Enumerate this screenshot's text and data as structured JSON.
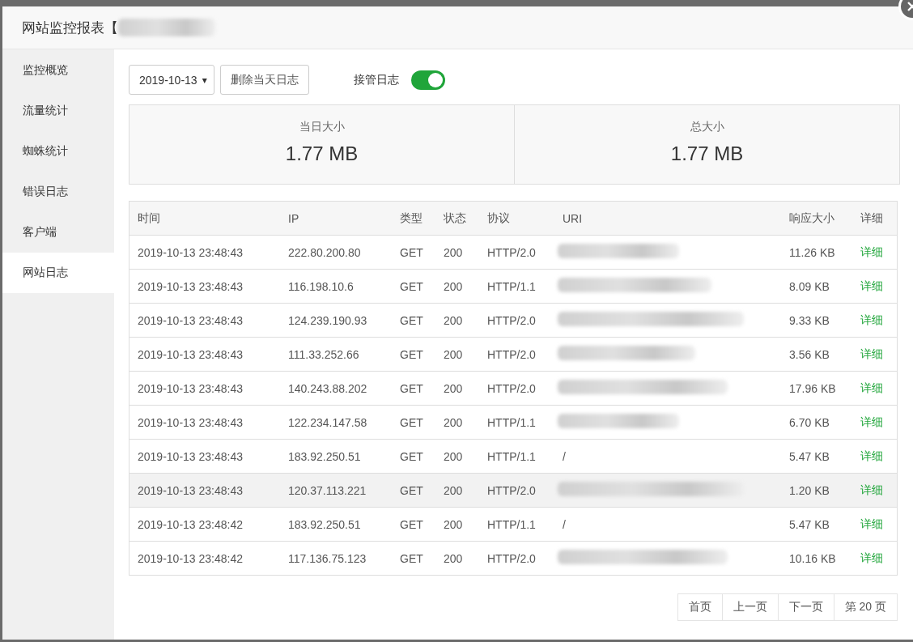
{
  "dialog": {
    "title": "网站监控报表【",
    "title_redacted": true
  },
  "sidebar": {
    "items": [
      {
        "label": "监控概览",
        "selected": false
      },
      {
        "label": "流量统计",
        "selected": false
      },
      {
        "label": "蜘蛛统计",
        "selected": false
      },
      {
        "label": "错误日志",
        "selected": false
      },
      {
        "label": "客户端",
        "selected": false
      },
      {
        "label": "网站日志",
        "selected": true
      }
    ]
  },
  "toolbar": {
    "date": "2019-10-13",
    "caret": "▾",
    "delete_button": "删除当天日志",
    "takeover_label": "接管日志",
    "takeover_on": true
  },
  "stats": [
    {
      "label": "当日大小",
      "value": "1.77 MB"
    },
    {
      "label": "总大小",
      "value": "1.77 MB"
    }
  ],
  "table": {
    "columns": [
      "时间",
      "IP",
      "类型",
      "状态",
      "协议",
      "URI",
      "响应大小",
      "详细"
    ],
    "rows": [
      {
        "time": "2019-10-13 23:48:43",
        "ip": "222.80.200.80",
        "type": "GET",
        "status": "200",
        "protocol": "HTTP/2.0",
        "uri_hidden": true,
        "size": "11.26 KB",
        "detail": "详细",
        "highlighted": false
      },
      {
        "time": "2019-10-13 23:48:43",
        "ip": "116.198.10.6",
        "type": "GET",
        "status": "200",
        "protocol": "HTTP/1.1",
        "uri_hidden": true,
        "size": "8.09 KB",
        "detail": "详细",
        "highlighted": false
      },
      {
        "time": "2019-10-13 23:48:43",
        "ip": "124.239.190.93",
        "type": "GET",
        "status": "200",
        "protocol": "HTTP/2.0",
        "uri_hidden": true,
        "size": "9.33 KB",
        "detail": "详细",
        "highlighted": false
      },
      {
        "time": "2019-10-13 23:48:43",
        "ip": "111.33.252.66",
        "type": "GET",
        "status": "200",
        "protocol": "HTTP/2.0",
        "uri_hidden": true,
        "size": "3.56 KB",
        "detail": "详细",
        "highlighted": false
      },
      {
        "time": "2019-10-13 23:48:43",
        "ip": "140.243.88.202",
        "type": "GET",
        "status": "200",
        "protocol": "HTTP/2.0",
        "uri_hidden": true,
        "size": "17.96 KB",
        "detail": "详细",
        "highlighted": false
      },
      {
        "time": "2019-10-13 23:48:43",
        "ip": "122.234.147.58",
        "type": "GET",
        "status": "200",
        "protocol": "HTTP/1.1",
        "uri_hidden": true,
        "size": "6.70 KB",
        "detail": "详细",
        "highlighted": false
      },
      {
        "time": "2019-10-13 23:48:43",
        "ip": "183.92.250.51",
        "type": "GET",
        "status": "200",
        "protocol": "HTTP/1.1",
        "uri": "/",
        "uri_hidden": false,
        "size": "5.47 KB",
        "detail": "详细",
        "highlighted": false
      },
      {
        "time": "2019-10-13 23:48:43",
        "ip": "120.37.113.221",
        "type": "GET",
        "status": "200",
        "protocol": "HTTP/2.0",
        "uri_hidden": true,
        "size": "1.20 KB",
        "detail": "详细",
        "highlighted": true
      },
      {
        "time": "2019-10-13 23:48:42",
        "ip": "183.92.250.51",
        "type": "GET",
        "status": "200",
        "protocol": "HTTP/1.1",
        "uri": "/",
        "uri_hidden": false,
        "size": "5.47 KB",
        "detail": "详细",
        "highlighted": false
      },
      {
        "time": "2019-10-13 23:48:42",
        "ip": "117.136.75.123",
        "type": "GET",
        "status": "200",
        "protocol": "HTTP/2.0",
        "uri_hidden": true,
        "size": "10.16 KB",
        "detail": "详细",
        "highlighted": false
      }
    ]
  },
  "pagination": [
    "首页",
    "上一页",
    "下一页",
    "第 20 页"
  ]
}
